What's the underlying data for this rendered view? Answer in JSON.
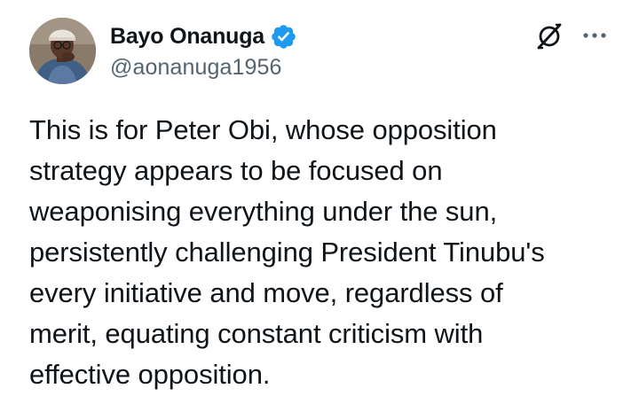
{
  "author": {
    "display_name": "Bayo Onanuga",
    "handle": "@aonanuga1956",
    "verified": true,
    "verified_color": "#1d9bf0"
  },
  "actions": {
    "grok_icon": "grok-slash-icon",
    "more_icon": "more-horizontal-icon"
  },
  "tweet": {
    "text": "This is for Peter Obi, whose opposition\nstrategy appears to be focused on\nweaponising everything under the sun,\npersistently challenging President Tinubu's\nevery initiative and move, regardless of\nmerit, equating constant criticism with\neffective opposition."
  },
  "colors": {
    "text_primary": "#0f1419",
    "text_secondary": "#536471",
    "brand_blue": "#1d9bf0"
  }
}
